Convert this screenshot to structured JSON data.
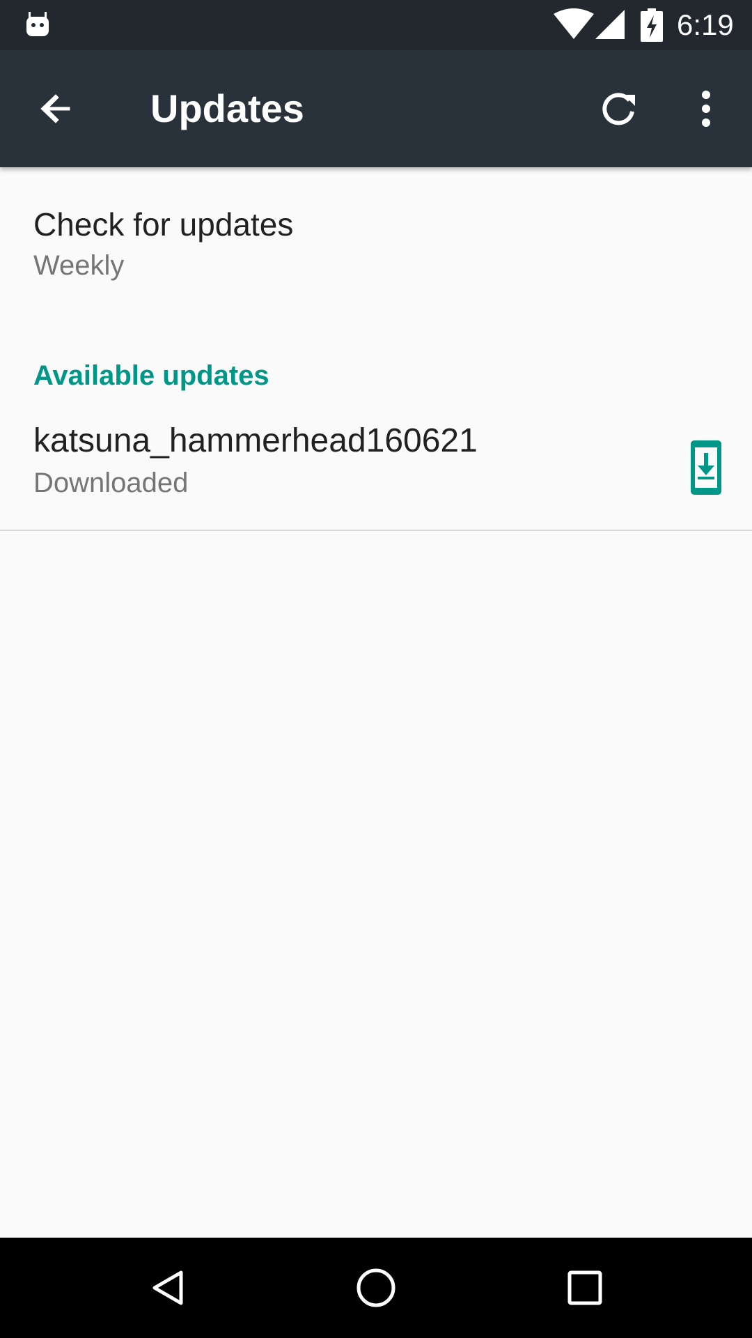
{
  "status_bar": {
    "time": "6:19",
    "icons": [
      "notification-icon",
      "wifi-icon",
      "cell-signal-icon",
      "battery-charging-icon"
    ]
  },
  "toolbar": {
    "title": "Updates",
    "back_icon": "arrow-back-icon",
    "refresh_icon": "refresh-icon",
    "overflow_icon": "more-vert-icon"
  },
  "preference": {
    "title": "Check for updates",
    "summary": "Weekly"
  },
  "available_updates": {
    "header": "Available updates",
    "items": [
      {
        "name": "katsuna_hammerhead160621",
        "status": "Downloaded",
        "action_icon": "system-update-icon"
      }
    ]
  },
  "navigation_bar": {
    "icons": [
      "nav-back-icon",
      "nav-home-icon",
      "nav-recents-icon"
    ]
  },
  "colors": {
    "status_bar": "#22282d",
    "toolbar": "#29323a",
    "background": "#fafafa",
    "accent": "#009688",
    "primary_text": "#212121",
    "secondary_text": "#757575",
    "nav_bar": "#000000"
  }
}
